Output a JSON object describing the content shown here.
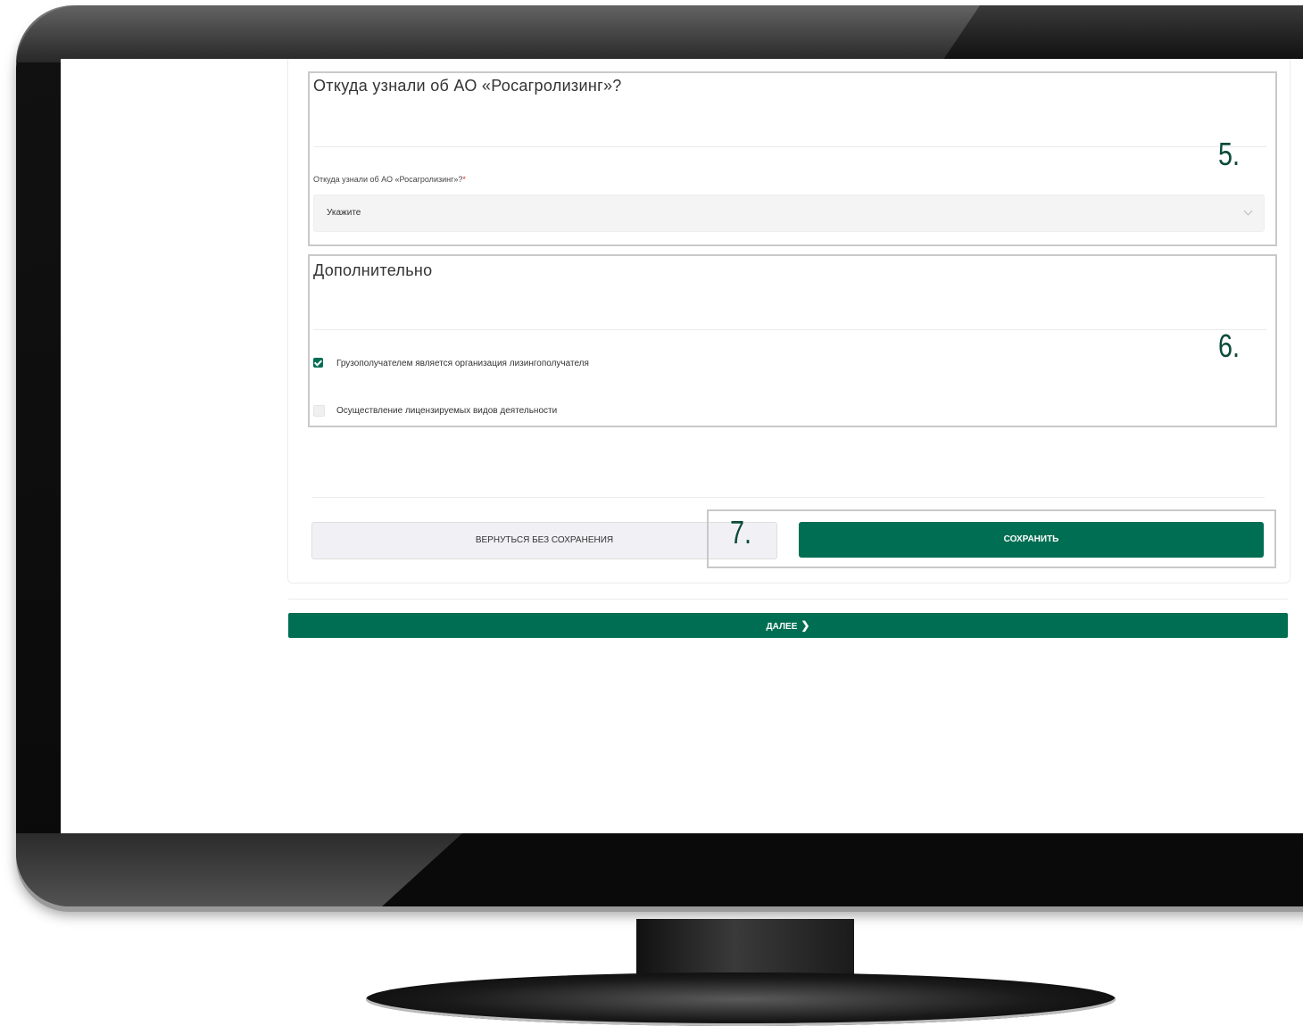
{
  "section_source": {
    "title": "Откуда узнали об АО «Росагролизинг»?",
    "field_label": "Откуда узнали об АО «Росагролизинг»?",
    "required_mark": "*",
    "select_value": "Укажите",
    "marker": "5."
  },
  "section_additional": {
    "title": "Дополнительно",
    "checkboxes": [
      {
        "label": "Грузополучателем является организация лизингополучателя",
        "checked": true
      },
      {
        "label": "Осуществление лицензируемых видов деятельности",
        "checked": false
      }
    ],
    "marker": "6."
  },
  "actions": {
    "back_label": "ВЕРНУТЬСЯ БЕЗ СОХРАНЕНИЯ",
    "save_label": "СОХРАНИТЬ",
    "marker": "7.",
    "next_label": "ДАЛЕЕ",
    "next_icon": "chevron-right-icon"
  },
  "colors": {
    "primary": "#006e52",
    "marker": "#0c4b3a"
  }
}
